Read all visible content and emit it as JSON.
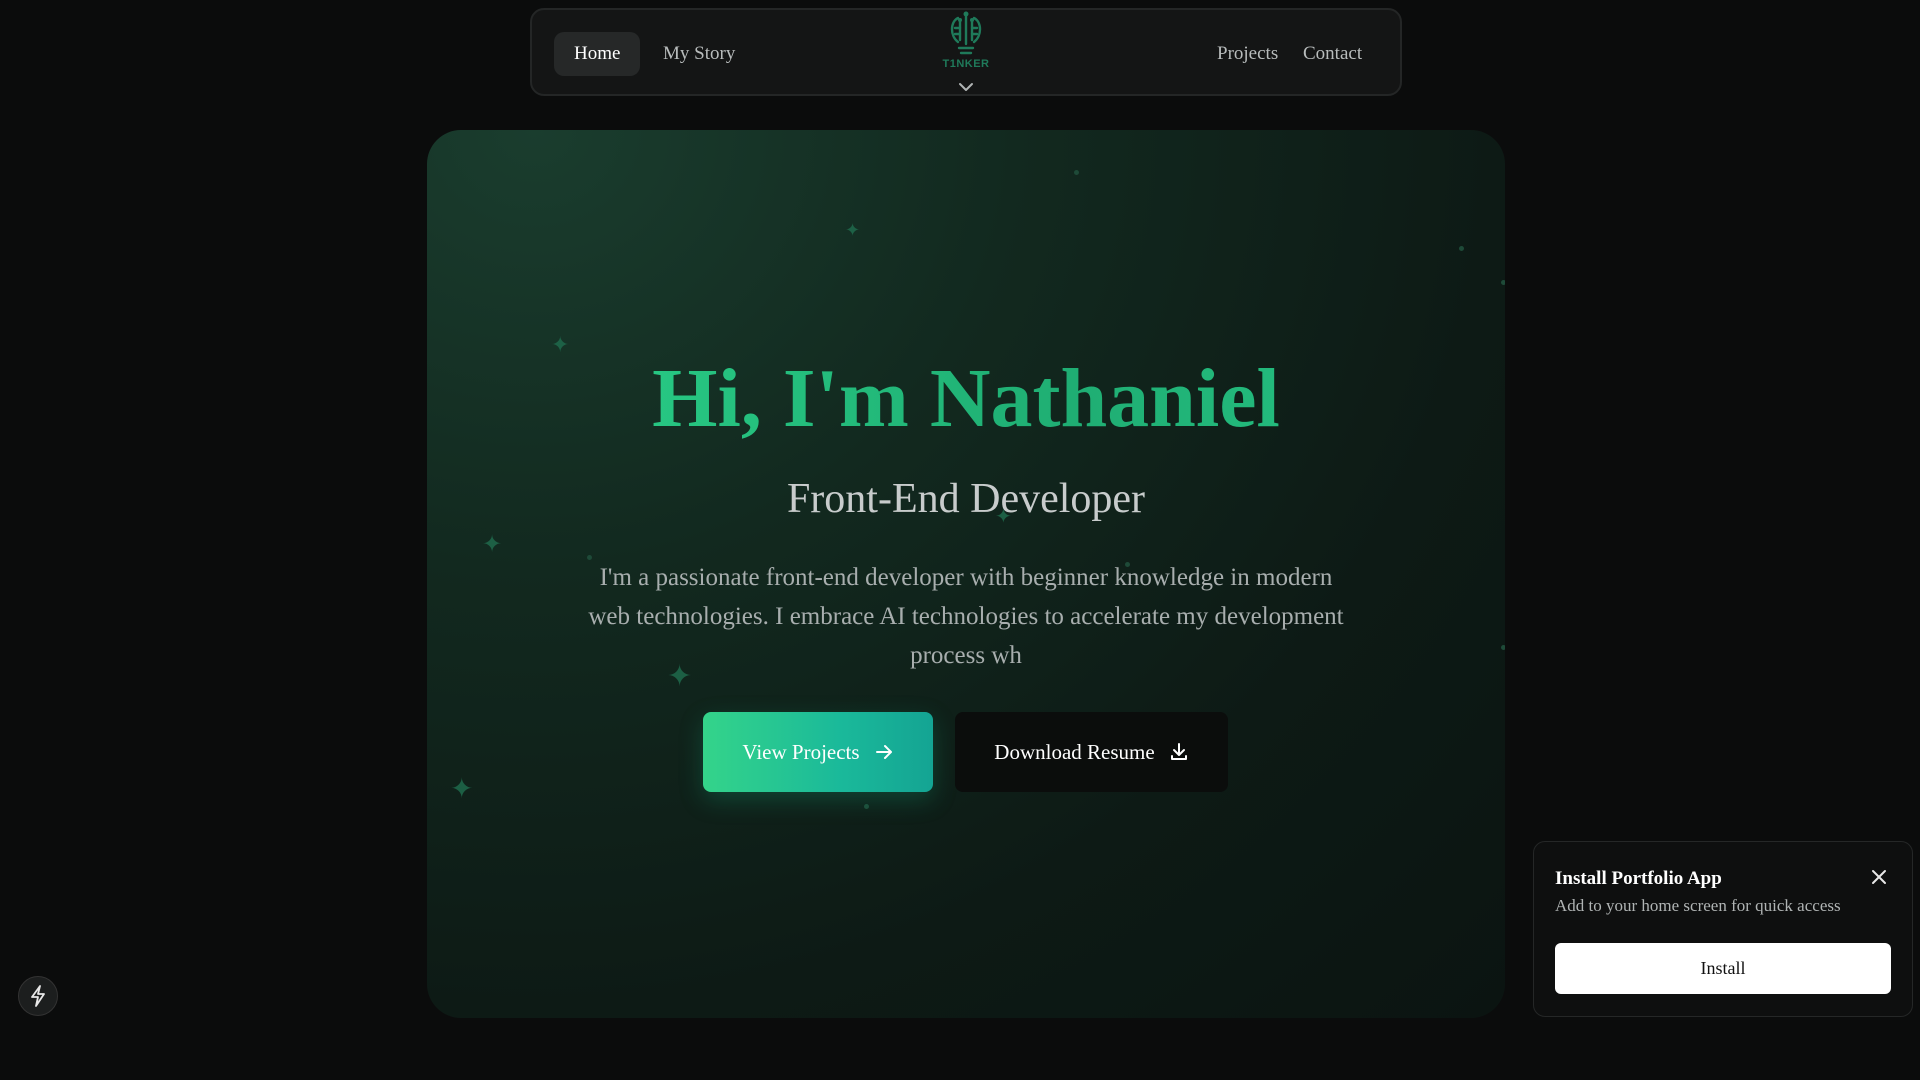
{
  "nav": {
    "items": [
      {
        "label": "Home",
        "active": true
      },
      {
        "label": "My Story",
        "active": false
      },
      {
        "label": "Projects",
        "active": false
      },
      {
        "label": "Contact",
        "active": false
      }
    ],
    "logo": {
      "text": "T1NKER",
      "icon": "lightbulb-circuit-icon",
      "dropdown_icon": "chevron-down-icon"
    }
  },
  "hero": {
    "title": "Hi, I'm Nathaniel",
    "subtitle": "Front-End Developer",
    "description": "I'm a passionate front-end developer with beginner knowledge in modern web technologies. I embrace AI technologies to accelerate my development process wh",
    "primary_button": {
      "label": "View Projects",
      "icon": "arrow-right-icon"
    },
    "secondary_button": {
      "label": "Download Resume",
      "icon": "download-icon"
    }
  },
  "install_prompt": {
    "title": "Install Portfolio App",
    "subtitle": "Add to your home screen for quick access",
    "button_label": "Install",
    "close_icon": "close-icon"
  },
  "floating_button": {
    "icon": "lightning-icon"
  },
  "colors": {
    "background": "#0b0c0c",
    "accent": "#25c07e",
    "hero_card": "#12291f",
    "nav_bg": "#141515",
    "install_button": "#ffffff"
  }
}
